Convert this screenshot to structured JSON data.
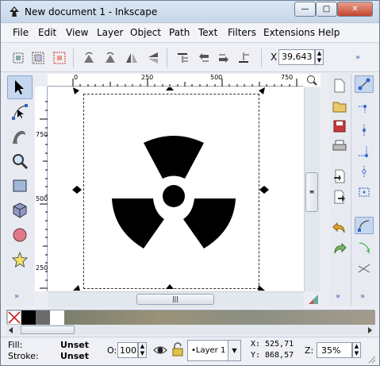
{
  "window": {
    "title": "New document 1 - Inkscape"
  },
  "menus": [
    "File",
    "Edit",
    "View",
    "Layer",
    "Object",
    "Path",
    "Text",
    "Filters",
    "Extensions",
    "Help"
  ],
  "xfield": {
    "label": "X",
    "value": "39,643"
  },
  "rulers": {
    "h": [
      "0",
      "250",
      "500",
      "750"
    ],
    "v": [
      "750",
      "500",
      "250"
    ]
  },
  "status": {
    "fill_label": "Fill:",
    "fill_value": "Unset",
    "stroke_label": "Stroke:",
    "stroke_value": "Unset",
    "opacity_label": "O:",
    "opacity_value": "100",
    "layer": "•Layer 1",
    "x_label": "X:",
    "x_value": "525,71",
    "y_label": "Y:",
    "y_value": "868,57",
    "zoom_label": "Z:",
    "zoom_value": "35%"
  },
  "icons": {
    "more": "»"
  },
  "colors": {
    "accent": "#3a62b5"
  }
}
